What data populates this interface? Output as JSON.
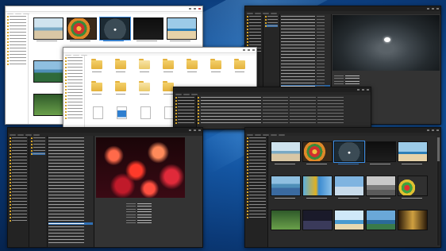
{
  "desktop": {
    "theme_colors": {
      "wallpaper": "#1456a3",
      "dark_window": "#2b2b2b",
      "light_window": "#f2f2f2",
      "selection": "#2f6fb4",
      "folder": "#e4b23c"
    }
  },
  "windows": [
    {
      "id": "thumbs-light",
      "theme": "light",
      "view": "thumbnails"
    },
    {
      "id": "preview-dark",
      "theme": "dark",
      "view": "single-image-preview"
    },
    {
      "id": "folders-light",
      "theme": "light",
      "view": "large-icons"
    },
    {
      "id": "details-dark",
      "theme": "dark",
      "view": "details-list"
    },
    {
      "id": "lantern-dark",
      "theme": "dark",
      "view": "list-with-preview"
    },
    {
      "id": "grid-dark",
      "theme": "dark",
      "view": "thumbnail-grid"
    }
  ],
  "icons": [
    "folder-icon",
    "document-icon",
    "image-thumbnail",
    "minimize-icon",
    "maximize-icon",
    "close-icon"
  ]
}
